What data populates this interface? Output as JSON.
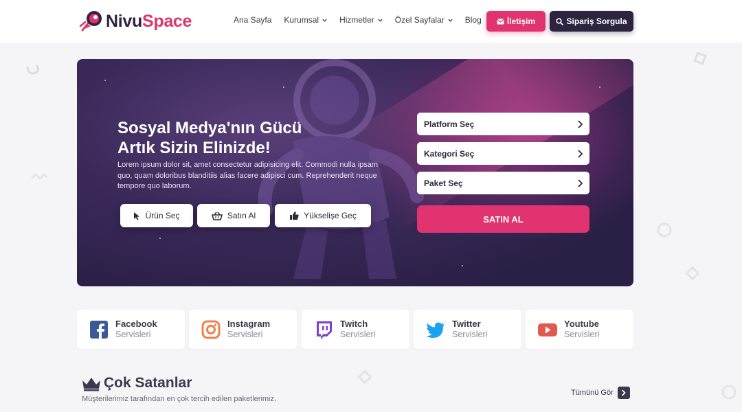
{
  "header": {
    "logo": {
      "part1": "Nivu",
      "part2": "Space"
    },
    "nav": [
      {
        "label": "Ana Sayfa",
        "has_dropdown": false
      },
      {
        "label": "Kurumsal",
        "has_dropdown": true
      },
      {
        "label": "Hizmetler",
        "has_dropdown": true
      },
      {
        "label": "Özel Sayfalar",
        "has_dropdown": true
      },
      {
        "label": "Blog",
        "has_dropdown": false
      }
    ],
    "contact_label": "İletişim",
    "order_label": "Sipariş Sorgula"
  },
  "hero": {
    "title_line1": "Sosyal Medya'nın Gücü",
    "title_line2": "Artık Sizin Elinizde!",
    "description": "Lorem ipsum dolor sit, amet consectetur adipisicing elit. Commodi nulla ipsam quo, quam doloribus blanditiis alias facere adipisci cum. Reprehenderit neque tempore quo laborum.",
    "buttons": [
      {
        "label": "Ürün Seç",
        "icon": "cursor-icon"
      },
      {
        "label": "Satın Al",
        "icon": "basket-icon"
      },
      {
        "label": "Yükselişe Geç",
        "icon": "thumbs-up-icon"
      }
    ],
    "selects": [
      {
        "label": "Platform Seç"
      },
      {
        "label": "Kategori Seç"
      },
      {
        "label": "Paket Seç"
      }
    ],
    "buy_label": "SATIN AL"
  },
  "services": [
    {
      "name": "Facebook",
      "sub": "Servisleri",
      "icon": "facebook-icon",
      "color": "#3b5998"
    },
    {
      "name": "Instagram",
      "sub": "Servisleri",
      "icon": "instagram-icon",
      "color": "#f0804a"
    },
    {
      "name": "Twitch",
      "sub": "Servisleri",
      "icon": "twitch-icon",
      "color": "#7b3fd1"
    },
    {
      "name": "Twitter",
      "sub": "Servisleri",
      "icon": "twitter-icon",
      "color": "#1da1f2"
    },
    {
      "name": "Youtube",
      "sub": "Servisleri",
      "icon": "youtube-icon",
      "color": "#e05a4e"
    }
  ],
  "bestsellers": {
    "title": "Çok Satanlar",
    "subtitle": "Müşterilerimiz tarafından en çok tercih edilen paketlerimiz.",
    "see_all_label": "Tümünü Gör"
  },
  "colors": {
    "accent": "#e0336f",
    "dark": "#2e2440",
    "hero_bg": "#3b2a5a"
  }
}
